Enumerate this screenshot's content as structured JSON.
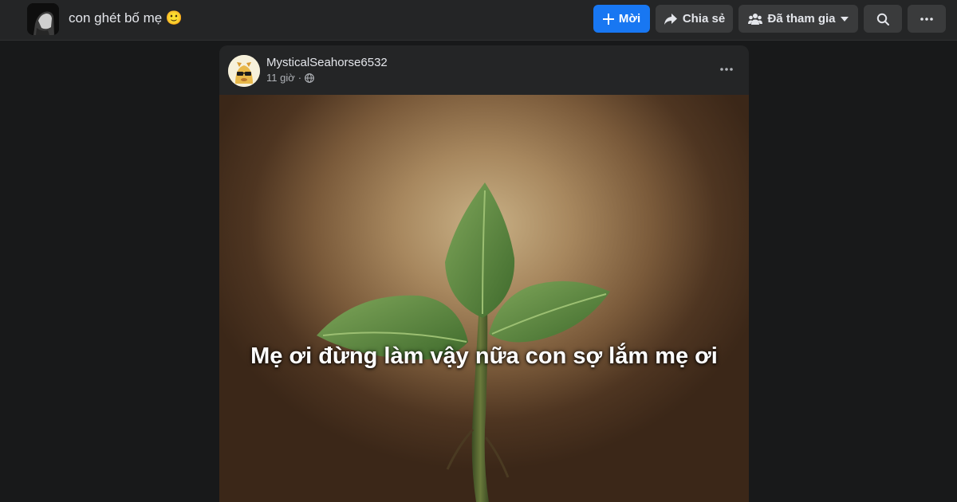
{
  "header": {
    "group_title": "con ghét bố mẹ 🙂",
    "buttons": {
      "invite": "Mời",
      "share": "Chia sẻ",
      "joined": "Đã tham gia"
    }
  },
  "post": {
    "author": "MysticalSeahorse6532",
    "time": "11 giờ",
    "image_caption": "Mẹ ơi đừng làm vậy nữa con sợ lắm mẹ ơi"
  },
  "colors": {
    "primary_button": "#1877f2",
    "secondary_button": "#3a3b3c",
    "topbar": "#242526",
    "card": "#242526"
  },
  "icons": {
    "invite": "plus-icon",
    "share": "share-arrow-icon",
    "joined": "group-icon",
    "dropdown": "caret-down-icon",
    "search": "search-icon",
    "more": "more-dots-icon",
    "audience": "globe-icon"
  }
}
